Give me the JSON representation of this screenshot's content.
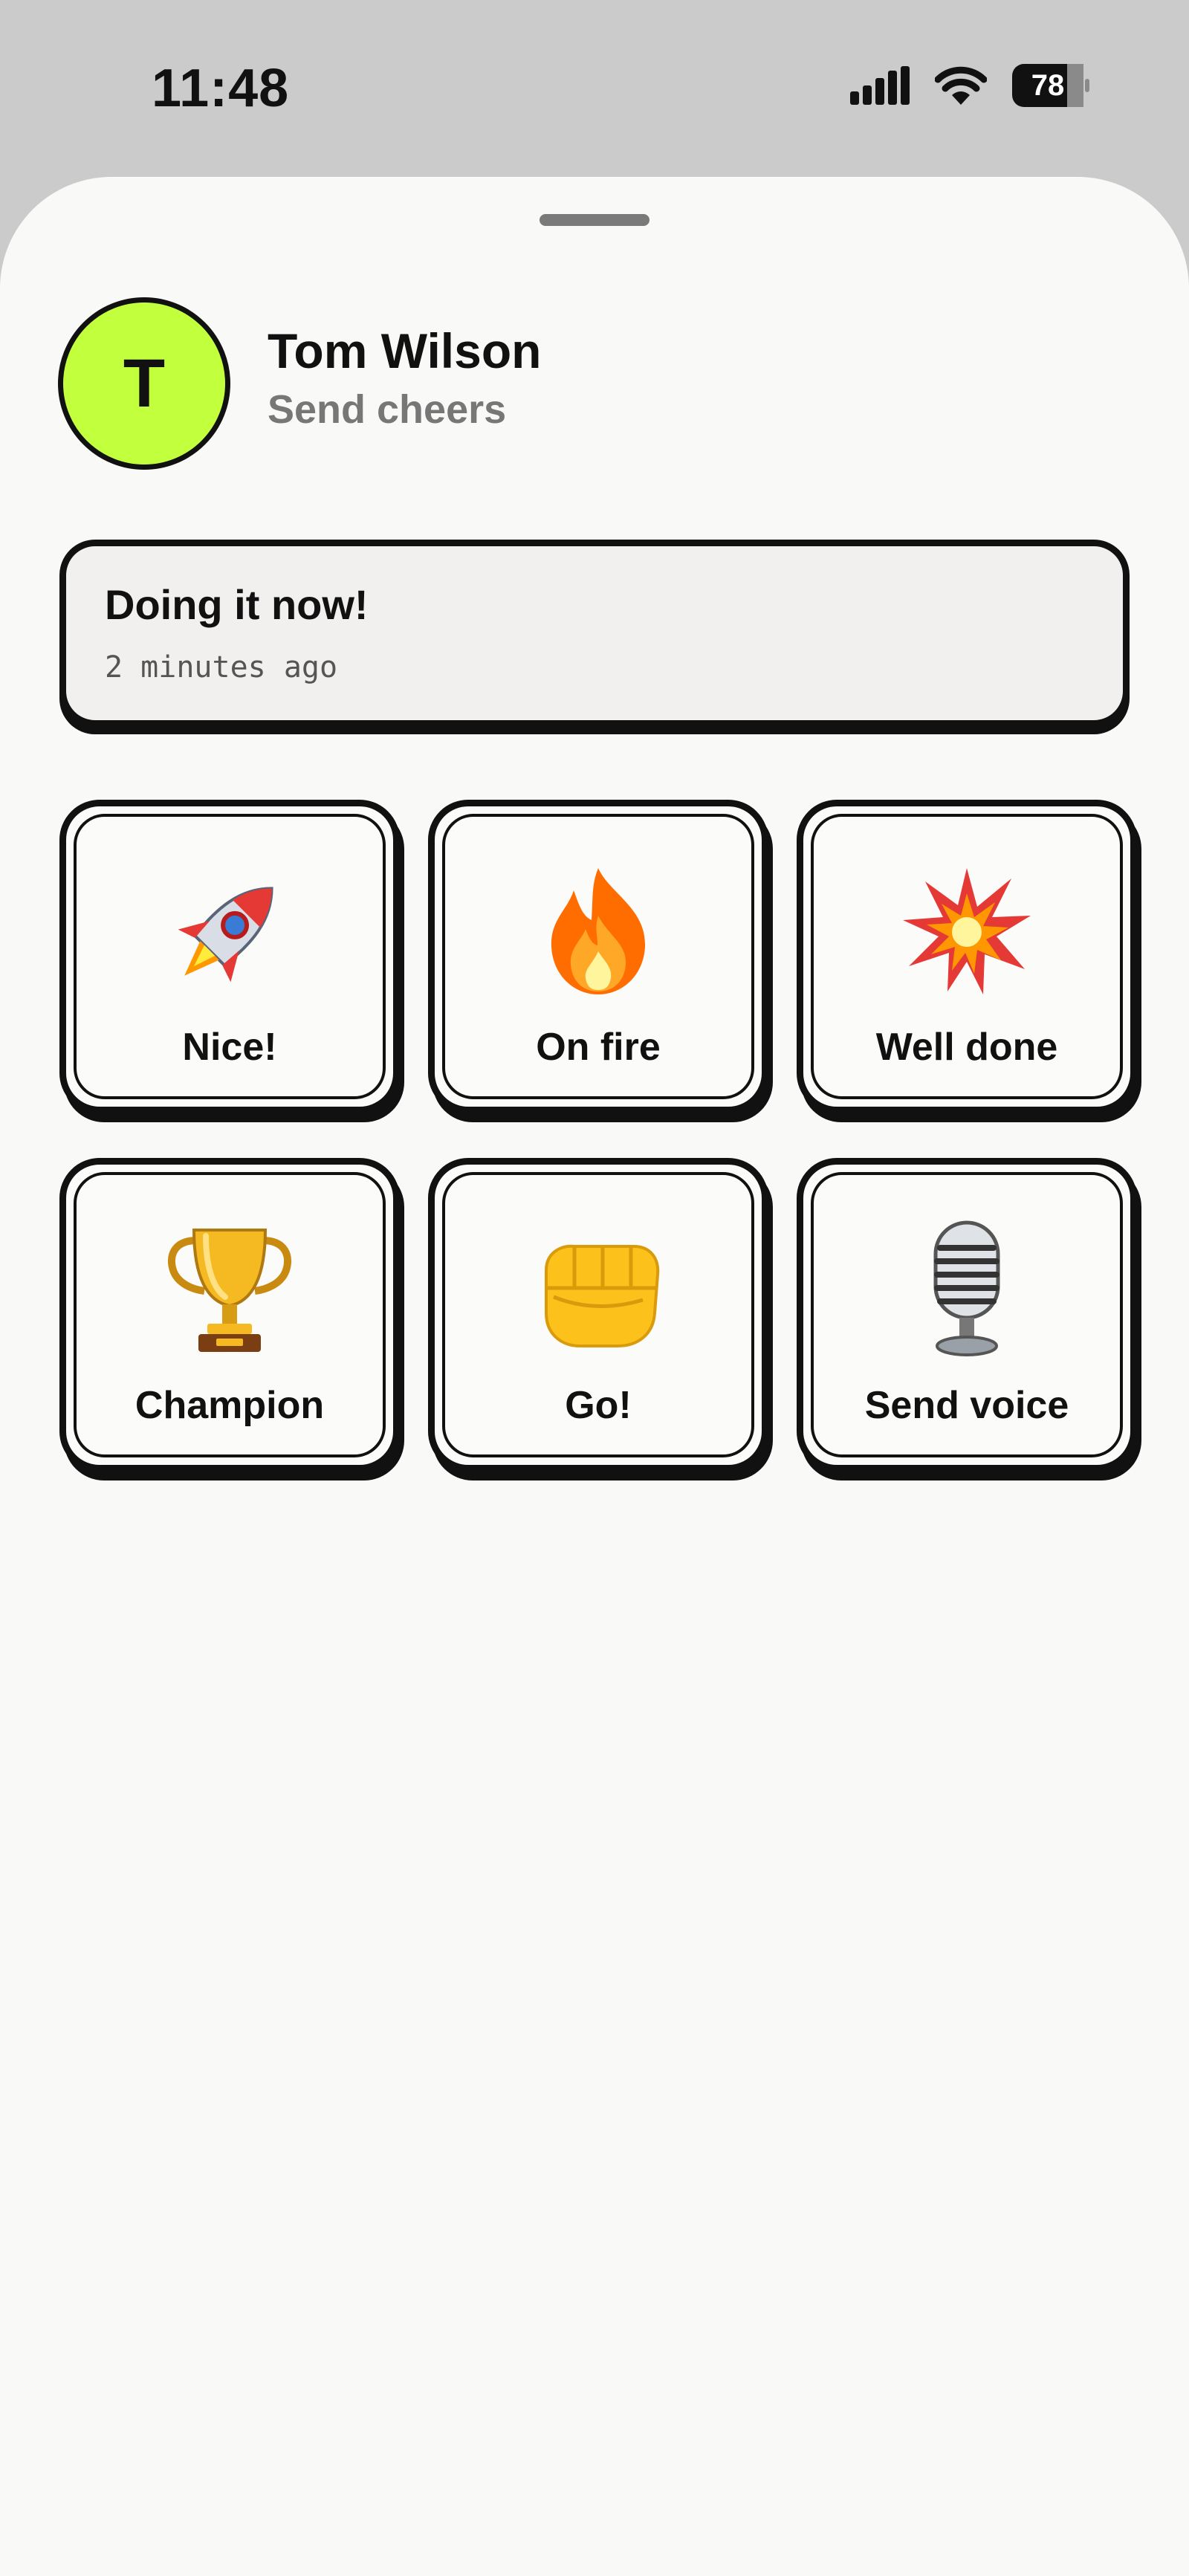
{
  "status_bar": {
    "time": "11:48",
    "battery": "78",
    "icons": [
      "signal-icon",
      "wifi-icon",
      "battery-icon"
    ]
  },
  "profile": {
    "initial": "T",
    "name": "Tom Wilson",
    "subtitle": "Send cheers",
    "avatar_color": "#c2ff3d"
  },
  "latest_status": {
    "message": "Doing it now!",
    "time_ago": "2 minutes ago"
  },
  "cheers": [
    {
      "label": "Nice!",
      "icon": "rocket-icon"
    },
    {
      "label": "On fire",
      "icon": "fire-icon"
    },
    {
      "label": "Well done",
      "icon": "explosion-icon"
    },
    {
      "label": "Champion",
      "icon": "trophy-icon"
    },
    {
      "label": "Go!",
      "icon": "fist-icon"
    },
    {
      "label": "Send voice",
      "icon": "microphone-icon"
    }
  ]
}
